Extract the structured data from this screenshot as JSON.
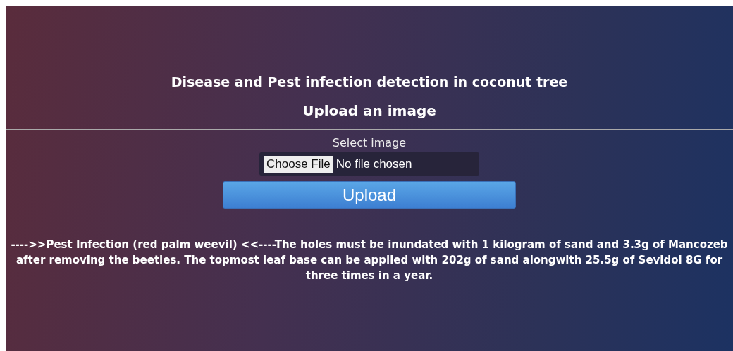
{
  "header": {
    "title": "Disease and Pest infection detection in coconut tree",
    "subtitle": "Upload an image"
  },
  "upload_form": {
    "label": "Select image",
    "file_button": "Choose File",
    "file_status": "No file chosen",
    "submit": "Upload"
  },
  "result": "---->>Pest Infection (red palm weevil) <<----The holes must be inundated with 1 kilogram of sand and 3.3g of Mancozeb after removing the beetles. The topmost leaf base can be applied with 202g of sand alongwith 25.5g of Sevidol 8G for three times in a year."
}
